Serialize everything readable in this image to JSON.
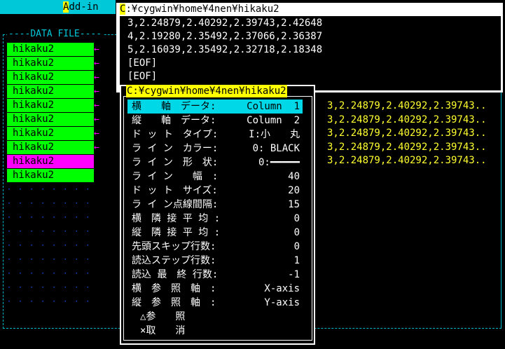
{
  "menubar": {
    "addin_hot": "A",
    "addin_rest": "dd-in"
  },
  "datafile": {
    "title": "DATA FILE",
    "rows": [
      {
        "label": "hikaku2",
        "state": "green",
        "arrow": "←"
      },
      {
        "label": "hikaku2",
        "state": "green",
        "arrow": "←"
      },
      {
        "label": "hikaku2",
        "state": "green",
        "arrow": "←"
      },
      {
        "label": "hikaku2",
        "state": "green",
        "arrow": "←"
      },
      {
        "label": "hikaku2",
        "state": "green",
        "arrow": "←"
      },
      {
        "label": "hikaku2",
        "state": "green",
        "arrow": "←"
      },
      {
        "label": "hikaku2",
        "state": "green",
        "arrow": "←"
      },
      {
        "label": "hikaku2",
        "state": "green",
        "arrow": "←"
      },
      {
        "label": "hikaku2",
        "state": "magenta",
        "arrow": ""
      },
      {
        "label": "hikaku2",
        "state": "green",
        "arrow": ""
      }
    ],
    "empty_rows": 9
  },
  "pathwin": {
    "title_hot": "C",
    "title_rest": ":¥cygwin¥home¥4nen¥hikaku2",
    "lines": [
      "3,2.24879,2.40292,2.39743,2.42648",
      "4,2.19280,2.35492,2.37066,2.36387",
      "5,2.16039,2.35492,2.32718,2.18348",
      "[EOF]",
      "[EOF]"
    ]
  },
  "right_lines": [
    "3,2.24879,2.40292,2.39743..",
    "3,2.24879,2.40292,2.39743..",
    "3,2.24879,2.40292,2.39743..",
    "3,2.24879,2.40292,2.39743..",
    "3,2.24879,2.40292,2.39743.."
  ],
  "popup": {
    "title": "C:¥cygwin¥home¥4nen¥hikaku2",
    "options": [
      {
        "label": "横　　軸　データ:",
        "value": "Column  1",
        "selected": true
      },
      {
        "label": "縦　　軸　データ:",
        "value": "Column  2",
        "selected": false
      },
      {
        "label": "ド ッ ト　タイプ:",
        "value": "I:小　　丸",
        "selected": false
      },
      {
        "label": "ラ イ ン　カラー:",
        "value": "0: BLACK",
        "selected": false
      },
      {
        "label": "ラ イ ン　形　状:",
        "value": "0:━━━━━",
        "selected": false
      },
      {
        "label": "ラ イ ン　　幅　:",
        "value": "40",
        "selected": false
      },
      {
        "label": "ド ッ ト　サイズ:",
        "value": "20",
        "selected": false
      },
      {
        "label": "ラ イ ン点線間隔:",
        "value": "15",
        "selected": false
      },
      {
        "label": "横　隣 接 平 均 :",
        "value": "0",
        "selected": false
      },
      {
        "label": "縦　隣 接 平 均 :",
        "value": "0",
        "selected": false
      },
      {
        "label": "先頭スキップ行数:",
        "value": "0",
        "selected": false
      },
      {
        "label": "読込ステップ行数:",
        "value": "1",
        "selected": false
      },
      {
        "label": "読込 最　終 行数:",
        "value": "-1",
        "selected": false
      },
      {
        "label": "横　参　照　軸　:",
        "value": "X-axis",
        "selected": false
      },
      {
        "label": "縦　参　照　軸　:",
        "value": "Y-axis",
        "selected": false
      }
    ],
    "commands": [
      {
        "label": "△参　　照"
      },
      {
        "label": "×取　　消"
      }
    ]
  }
}
